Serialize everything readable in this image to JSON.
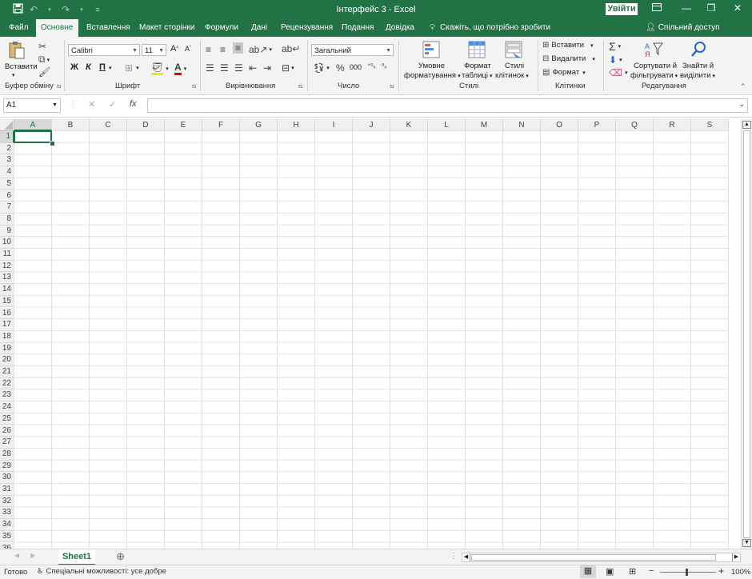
{
  "title": "Інтерфейс 3  -  Excel",
  "login_label": "Увійти",
  "tabs": [
    "Файл",
    "Основне",
    "Вставлення",
    "Макет сторінки",
    "Формули",
    "Дані",
    "Рецензування",
    "Подання",
    "Довідка"
  ],
  "tell_me": "Скажіть, що потрібно зробити",
  "share": "Спільний доступ",
  "ribbon": {
    "paste": "Вставити",
    "clipboard_group": "Буфер обміну",
    "font_name": "Calibri",
    "font_size": "11",
    "bold": "Ж",
    "italic": "К",
    "underline": "П",
    "font_group": "Шрифт",
    "align_group": "Вирівнювання",
    "number_format": "Загальний",
    "number_group": "Число",
    "cond_format_1": "Умовне",
    "cond_format_2": "форматування",
    "format_table_1": "Формат",
    "format_table_2": "таблиці",
    "cell_styles_1": "Стилі",
    "cell_styles_2": "клітинок",
    "styles_group": "Стилі",
    "insert": "Вставити",
    "delete": "Видалити",
    "format": "Формат",
    "cells_group": "Клітинки",
    "sort_1": "Сортувати й",
    "sort_2": "фільтрувати",
    "find_1": "Знайти й",
    "find_2": "виділити",
    "editing_group": "Редагування"
  },
  "name_box": "A1",
  "fx": "fx",
  "columns": [
    "A",
    "B",
    "C",
    "D",
    "E",
    "F",
    "G",
    "H",
    "I",
    "J",
    "K",
    "L",
    "M",
    "N",
    "O",
    "P",
    "Q",
    "R",
    "S"
  ],
  "rows": [
    "1",
    "2",
    "3",
    "4",
    "5",
    "6",
    "7",
    "8",
    "9",
    "10",
    "11",
    "12",
    "13",
    "14",
    "15",
    "16",
    "17",
    "18",
    "19",
    "20",
    "21",
    "22",
    "23",
    "24",
    "25",
    "26",
    "27",
    "28",
    "29",
    "30",
    "31",
    "32",
    "33",
    "34",
    "35",
    "36"
  ],
  "sheet_tab": "Sheet1",
  "status_ready": "Готово",
  "accessibility": "Спеціальні можливості: усе добре",
  "zoom": "100%",
  "colors": {
    "brand": "#217346",
    "ribbon_bg": "#f3f3f3"
  },
  "icons": [
    "save-icon",
    "undo-icon",
    "redo-icon",
    "customize-icon",
    "ribbon-display-icon",
    "minimize-icon",
    "restore-icon",
    "close-icon",
    "lightbulb-icon",
    "person-icon"
  ]
}
